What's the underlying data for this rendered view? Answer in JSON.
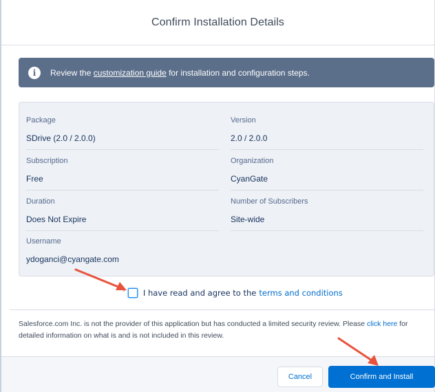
{
  "header": {
    "title": "Confirm Installation Details"
  },
  "banner": {
    "icon": "info-icon",
    "text_before": "Review the ",
    "link_text": "customization guide",
    "text_after": " for installation and configuration steps."
  },
  "details": {
    "package": {
      "label": "Package",
      "value": "SDrive (2.0 / 2.0.0)"
    },
    "version": {
      "label": "Version",
      "value": "2.0 / 2.0.0"
    },
    "subscription": {
      "label": "Subscription",
      "value": "Free"
    },
    "organization": {
      "label": "Organization",
      "value": "CyanGate"
    },
    "duration": {
      "label": "Duration",
      "value": "Does Not Expire"
    },
    "subscribers": {
      "label": "Number of Subscribers",
      "value": "Site-wide"
    },
    "username": {
      "label": "Username",
      "value": "ydoganci@cyangate.com"
    }
  },
  "agreement": {
    "required_marker": "*",
    "text": "I have read and agree to the",
    "link_text": "terms and conditions",
    "checked": false
  },
  "disclaimer": {
    "text": "Salesforce.com Inc. is not the provider of this application but has conducted a limited security review. Please ",
    "link_text": "click here",
    "text_after": " for detailed information on what is and is not included in this review."
  },
  "footer": {
    "cancel_label": "Cancel",
    "install_label": "Confirm and Install"
  },
  "colors": {
    "banner": "#5b6e8a",
    "primary": "#0070d2",
    "link": "#006dcc",
    "annotation_arrow": "#e8523c"
  }
}
